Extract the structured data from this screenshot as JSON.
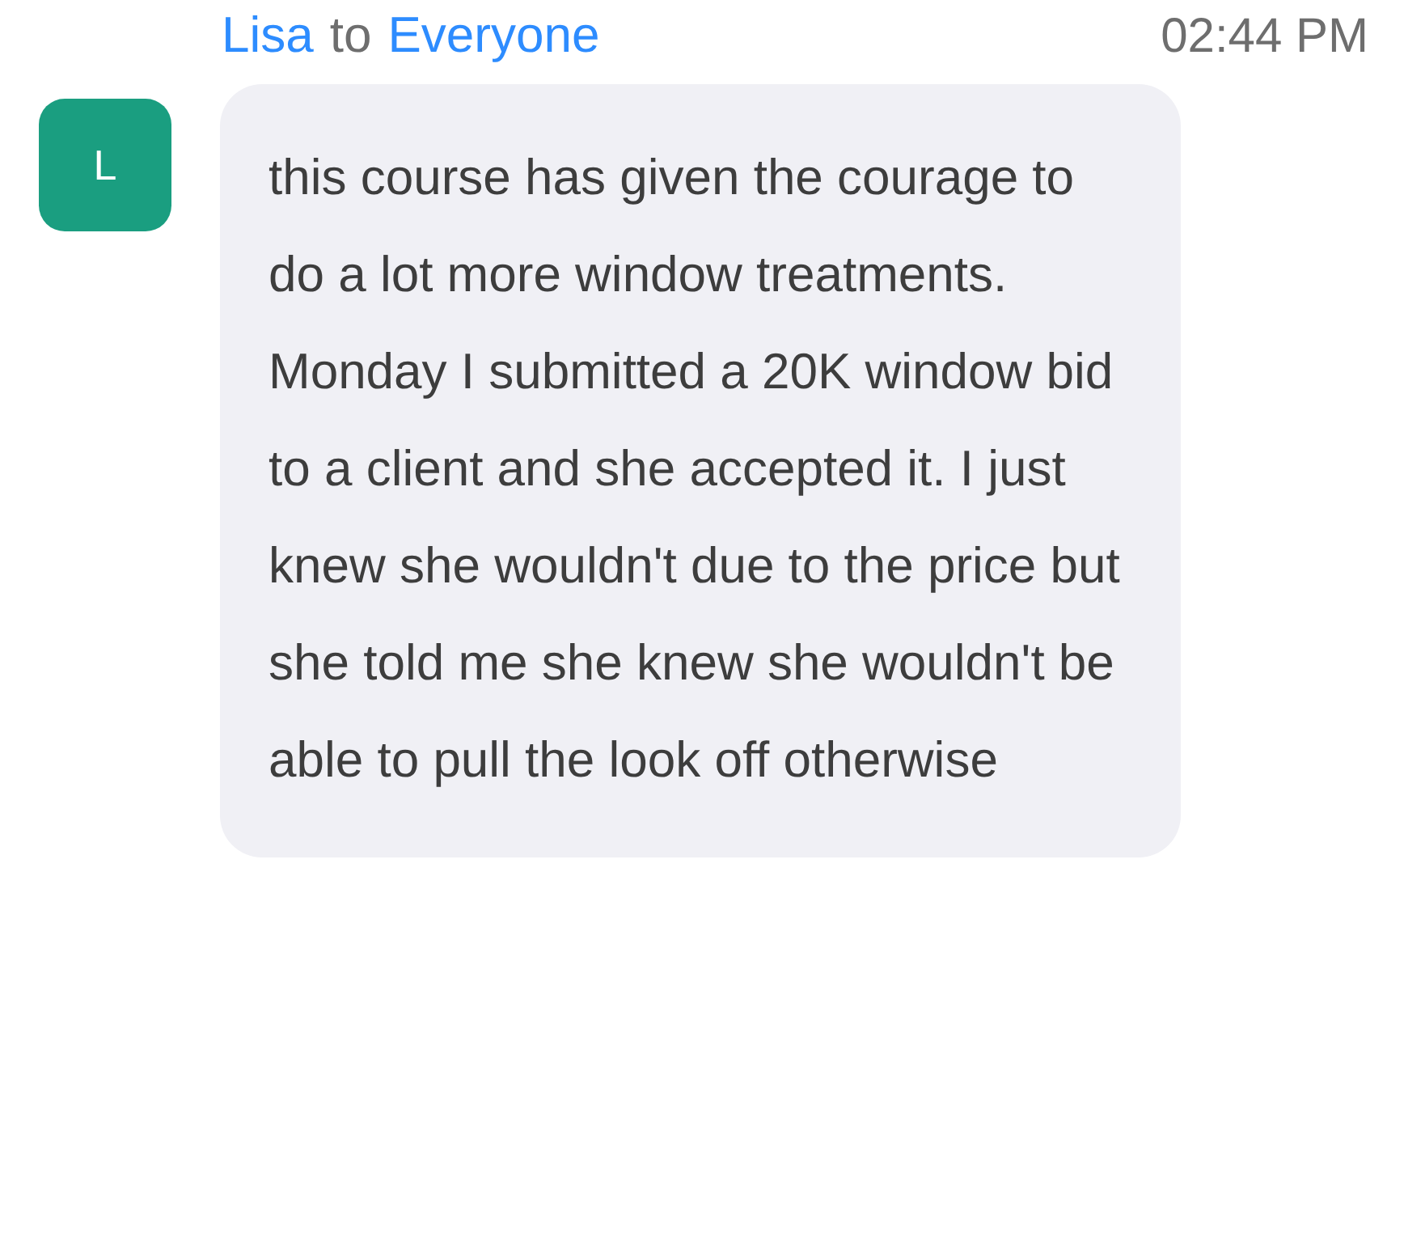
{
  "message": {
    "sender": "Lisa",
    "connector": "to",
    "recipient": "Everyone",
    "time": "02:44 PM",
    "avatar": {
      "initial": "L",
      "color": "#1a9e80"
    },
    "text": "this course has given the courage to do a lot more window treatments. Monday I submitted a 20K window bid to a client and she accepted it. I just knew she wouldn't due to the price but she told me she knew she wouldn't be able to pull the look off otherwise"
  }
}
